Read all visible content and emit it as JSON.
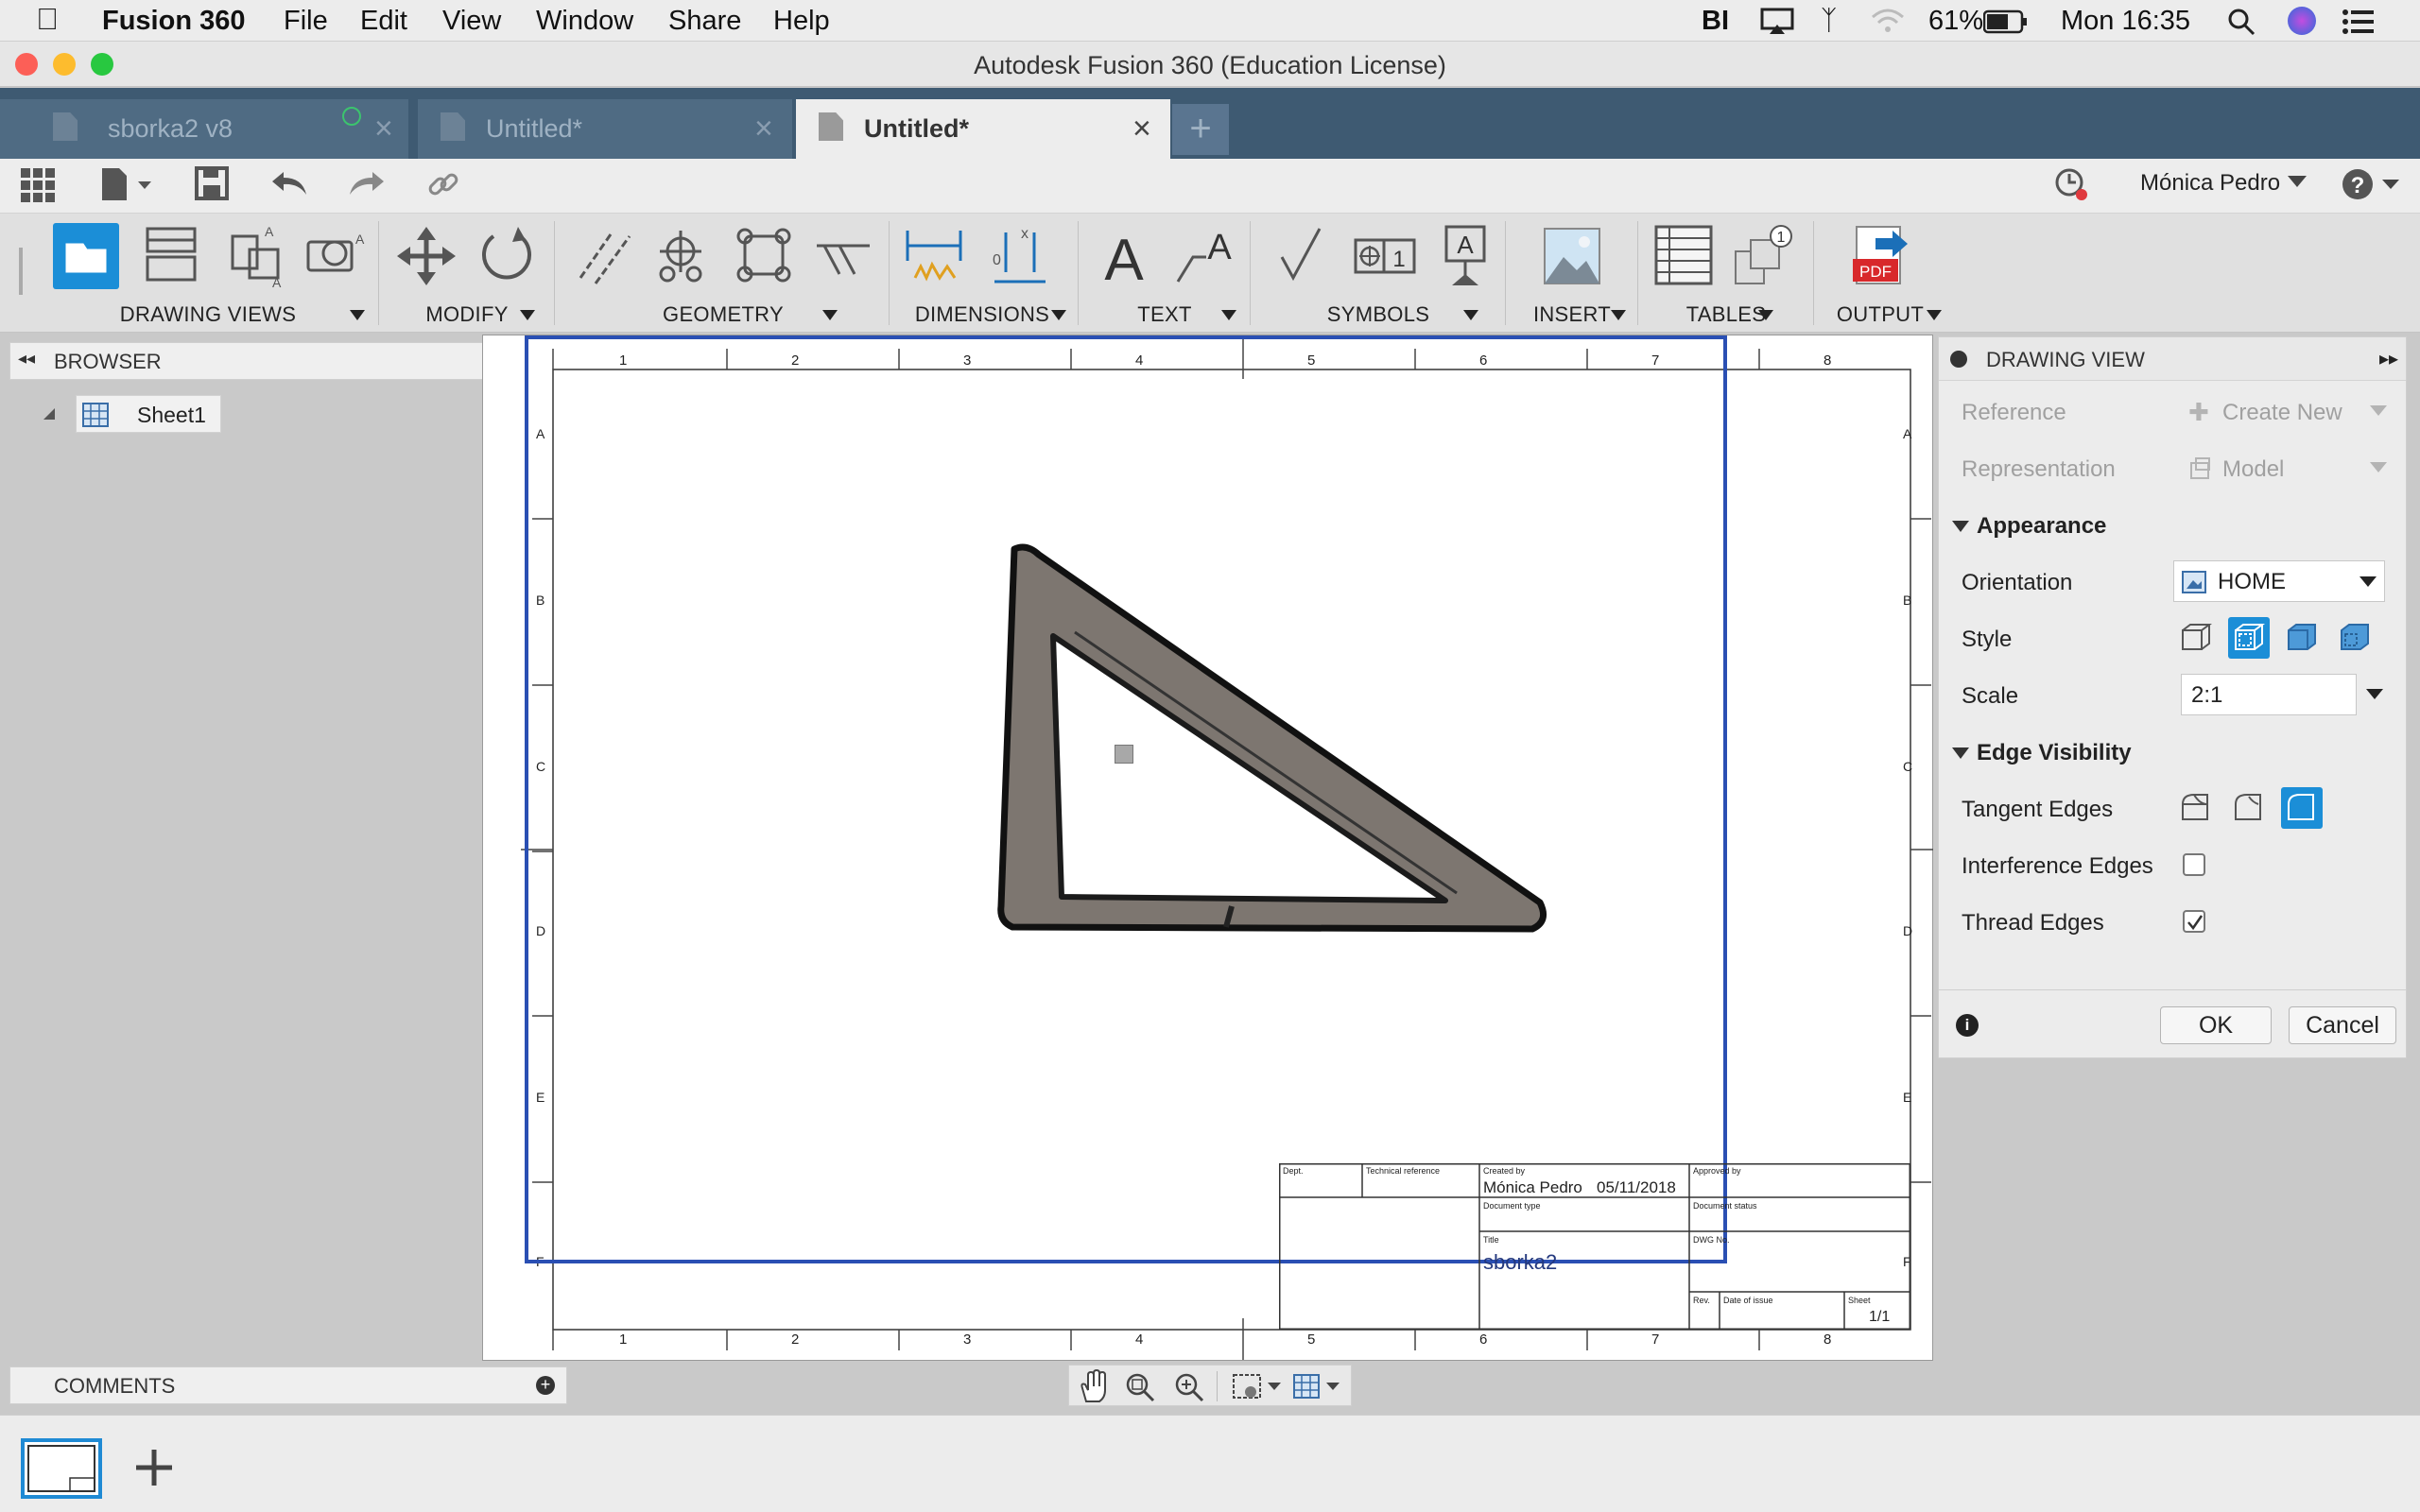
{
  "os_menu": {
    "app_name": "Fusion 360",
    "items": [
      "File",
      "Edit",
      "View",
      "Window",
      "Share",
      "Help"
    ],
    "battery": "61%",
    "clock": "Mon 16:35"
  },
  "window": {
    "title": "Autodesk Fusion 360 (Education License)"
  },
  "doc_tabs": [
    {
      "label": "sborka2 v8"
    },
    {
      "label": "Untitled*"
    },
    {
      "label": "Untitled*"
    }
  ],
  "user": {
    "name": "Mónica Pedro"
  },
  "ribbon": {
    "groups": [
      "DRAWING VIEWS",
      "MODIFY",
      "GEOMETRY",
      "DIMENSIONS",
      "TEXT",
      "SYMBOLS",
      "INSERT",
      "TABLES",
      "OUTPUT"
    ]
  },
  "browser": {
    "title": "BROWSER",
    "sheet": "Sheet1"
  },
  "comments": {
    "title": "COMMENTS"
  },
  "sheet": {
    "col_labels": [
      "1",
      "2",
      "3",
      "4",
      "5",
      "6",
      "7",
      "8"
    ],
    "row_labels": [
      "A",
      "B",
      "C",
      "D",
      "E",
      "F"
    ]
  },
  "title_block": {
    "dept_label": "Dept.",
    "tech_ref_label": "Technical reference",
    "created_by_label": "Created by",
    "created_by": "Mónica Pedro",
    "date": "05/11/2018",
    "approved_by_label": "Approved by",
    "doc_type_label": "Document type",
    "doc_status_label": "Document status",
    "title_label": "Title",
    "title": "sborka2",
    "dwg_no_label": "DWG No.",
    "rev_label": "Rev.",
    "date_of_issue_label": "Date of issue",
    "sheet_label": "Sheet",
    "sheet_value": "1/1"
  },
  "panel": {
    "title": "DRAWING VIEW",
    "reference_label": "Reference",
    "reference_value": "Create New",
    "representation_label": "Representation",
    "representation_value": "Model",
    "appearance_label": "Appearance",
    "orientation_label": "Orientation",
    "orientation_value": "HOME",
    "style_label": "Style",
    "scale_label": "Scale",
    "scale_value": "2:1",
    "edge_visibility_label": "Edge Visibility",
    "tangent_edges_label": "Tangent Edges",
    "interference_edges_label": "Interference Edges",
    "thread_edges_label": "Thread Edges",
    "interference_checked": false,
    "thread_checked": true,
    "ok_label": "OK",
    "cancel_label": "Cancel"
  },
  "colors": {
    "accent": "#1b8ed7",
    "tab_strip": "#3e5a72",
    "part_fill": "#7d7670",
    "view_border": "#2a4fb3"
  }
}
